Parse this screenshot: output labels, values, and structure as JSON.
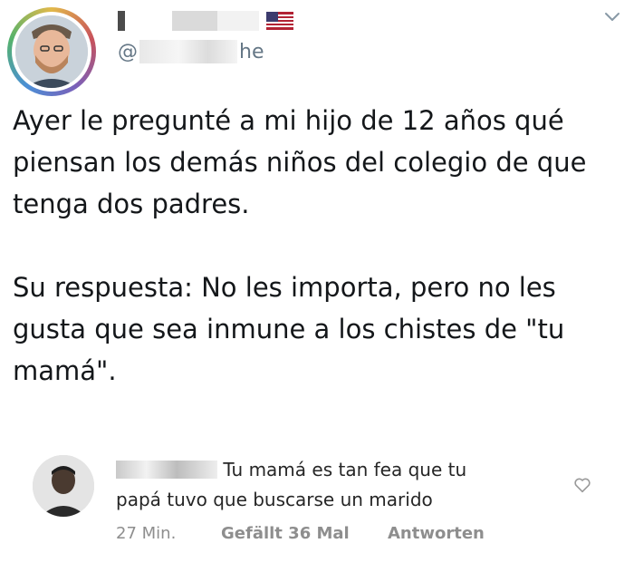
{
  "tweet": {
    "author": {
      "handle_prefix": "@",
      "handle_suffix": "he"
    },
    "paragraphs": [
      "Ayer le pregunté a mi hijo de 12 años qué piensan los demás niños del colegio de que tenga dos padres.",
      "Su respuesta: No les importa, pero no les gusta que sea inmune a los chistes de \"tu mamá\"."
    ]
  },
  "comment": {
    "text": "Tu mamá es tan fea que tu papá tuvo que buscarse un marido",
    "time": "27 Min.",
    "likes": "Gefällt 36 Mal",
    "reply": "Antworten"
  },
  "icons": {
    "chevron": "chevron-down-icon",
    "heart": "heart-icon",
    "flag": "us-flag-icon"
  },
  "colors": {
    "text": "#14171a",
    "secondary": "#657786",
    "comment_meta": "#8e8e8e"
  }
}
